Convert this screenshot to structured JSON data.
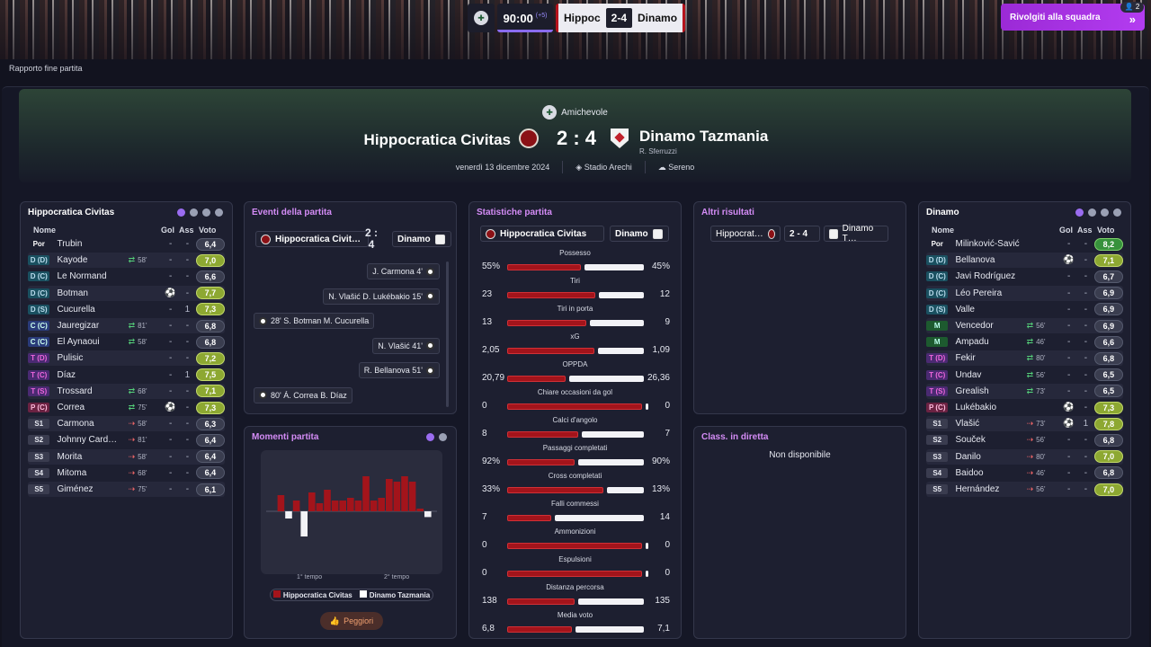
{
  "topbar": {
    "clock": "90:00",
    "added": "(+5)",
    "home": "Hippoc",
    "score": "2-4",
    "away": "Dinamo",
    "squad_btn": "Rivolgiti alla squadra",
    "badge": "2"
  },
  "breadcrumb": "Rapporto fine partita",
  "header": {
    "competition": "Amichevole",
    "home": "Hippocratica Civitas",
    "score": "2 : 4",
    "away": "Dinamo Tazmania",
    "referee": "R. Sferruzzi",
    "date": "venerdì 13 dicembre 2024",
    "stadium": "Stadio Arechi",
    "weather": "Sereno"
  },
  "home_panel": {
    "title": "Hippocratica Civitas",
    "cols": {
      "name": "Nome",
      "gol": "Gol",
      "ass": "Ass",
      "voto": "Voto"
    },
    "players": [
      {
        "pos": "Por",
        "name": "Trubin",
        "sub": "",
        "gol": "-",
        "ass": "-",
        "voto": "6,4"
      },
      {
        "pos": "D (D)",
        "name": "Kayode",
        "sub": "58'",
        "gol": "-",
        "ass": "-",
        "voto": "7,0"
      },
      {
        "pos": "D (C)",
        "name": "Le Normand",
        "sub": "",
        "gol": "-",
        "ass": "-",
        "voto": "6,6"
      },
      {
        "pos": "D (C)",
        "name": "Botman",
        "sub": "",
        "gol": "⚽",
        "ass": "-",
        "voto": "7,7"
      },
      {
        "pos": "D (S)",
        "name": "Cucurella",
        "sub": "",
        "gol": "-",
        "ass": "1",
        "voto": "7,3"
      },
      {
        "pos": "C (C)",
        "name": "Jauregizar",
        "sub": "81'",
        "gol": "-",
        "ass": "-",
        "voto": "6,8"
      },
      {
        "pos": "C (C)",
        "name": "El Aynaoui",
        "sub": "58'",
        "gol": "-",
        "ass": "-",
        "voto": "6,8"
      },
      {
        "pos": "T (D)",
        "name": "Pulisic",
        "sub": "",
        "gol": "-",
        "ass": "-",
        "voto": "7,2"
      },
      {
        "pos": "T (C)",
        "name": "Díaz",
        "sub": "",
        "gol": "-",
        "ass": "1",
        "voto": "7,5"
      },
      {
        "pos": "T (S)",
        "name": "Trossard",
        "sub": "68'",
        "gol": "-",
        "ass": "-",
        "voto": "7,1"
      },
      {
        "pos": "P (C)",
        "name": "Correa",
        "sub": "75'",
        "gol": "⚽",
        "ass": "-",
        "voto": "7,3"
      },
      {
        "pos": "S1",
        "name": "Carmona",
        "sub": "58'",
        "gol": "-",
        "ass": "-",
        "voto": "6,3"
      },
      {
        "pos": "S2",
        "name": "Johnny Card…",
        "sub": "81'",
        "gol": "-",
        "ass": "-",
        "voto": "6,4"
      },
      {
        "pos": "S3",
        "name": "Morita",
        "sub": "58'",
        "gol": "-",
        "ass": "-",
        "voto": "6,4"
      },
      {
        "pos": "S4",
        "name": "Mitoma",
        "sub": "68'",
        "gol": "-",
        "ass": "-",
        "voto": "6,4"
      },
      {
        "pos": "S5",
        "name": "Giménez",
        "sub": "75'",
        "gol": "-",
        "ass": "-",
        "voto": "6,1"
      }
    ]
  },
  "away_panel": {
    "title": "Dinamo",
    "cols": {
      "name": "Nome",
      "gol": "Gol",
      "ass": "Ass",
      "voto": "Voto"
    },
    "players": [
      {
        "pos": "Por",
        "name": "Milinković-Savić",
        "sub": "",
        "gol": "-",
        "ass": "-",
        "voto": "8,2"
      },
      {
        "pos": "D (D)",
        "name": "Bellanova",
        "sub": "",
        "gol": "⚽",
        "ass": "-",
        "voto": "7,1"
      },
      {
        "pos": "D (C)",
        "name": "Javi Rodríguez",
        "sub": "",
        "gol": "-",
        "ass": "-",
        "voto": "6,7"
      },
      {
        "pos": "D (C)",
        "name": "Léo Pereira",
        "sub": "",
        "gol": "-",
        "ass": "-",
        "voto": "6,9"
      },
      {
        "pos": "D (S)",
        "name": "Valle",
        "sub": "",
        "gol": "-",
        "ass": "-",
        "voto": "6,9"
      },
      {
        "pos": "M",
        "name": "Vencedor",
        "sub": "56'",
        "gol": "-",
        "ass": "-",
        "voto": "6,9"
      },
      {
        "pos": "M",
        "name": "Ampadu",
        "sub": "46'",
        "gol": "-",
        "ass": "-",
        "voto": "6,6"
      },
      {
        "pos": "T (D)",
        "name": "Fekir",
        "sub": "80'",
        "gol": "-",
        "ass": "-",
        "voto": "6,8"
      },
      {
        "pos": "T (C)",
        "name": "Undav",
        "sub": "56'",
        "gol": "-",
        "ass": "-",
        "voto": "6,5"
      },
      {
        "pos": "T (S)",
        "name": "Grealish",
        "sub": "73'",
        "gol": "-",
        "ass": "-",
        "voto": "6,5"
      },
      {
        "pos": "P (C)",
        "name": "Lukébakio",
        "sub": "",
        "gol": "⚽",
        "ass": "-",
        "voto": "7,3"
      },
      {
        "pos": "S1",
        "name": "Vlašić",
        "sub": "73'",
        "gol": "⚽",
        "ass": "1",
        "voto": "7,8"
      },
      {
        "pos": "S2",
        "name": "Souček",
        "sub": "56'",
        "gol": "-",
        "ass": "-",
        "voto": "6,8"
      },
      {
        "pos": "S3",
        "name": "Danilo",
        "sub": "80'",
        "gol": "-",
        "ass": "-",
        "voto": "7,0"
      },
      {
        "pos": "S4",
        "name": "Baidoo",
        "sub": "46'",
        "gol": "-",
        "ass": "-",
        "voto": "6,8"
      },
      {
        "pos": "S5",
        "name": "Hernández",
        "sub": "56'",
        "gol": "-",
        "ass": "-",
        "voto": "7,0"
      }
    ]
  },
  "events": {
    "title": "Eventi della partita",
    "home": "Hippocratica Civit…",
    "score": "2 : 4",
    "away": "Dinamo",
    "items": [
      {
        "side": "away",
        "text": "J. Carmona 4'"
      },
      {
        "side": "away",
        "text": "N. Vlašić D. Lukébakio 15'"
      },
      {
        "side": "home",
        "text": "28' S. Botman M. Cucurella"
      },
      {
        "side": "away",
        "text": "N. Vlašić 41'"
      },
      {
        "side": "away",
        "text": "R. Bellanova 51'"
      },
      {
        "side": "home",
        "text": "80' Á. Correa B. Díaz"
      }
    ]
  },
  "moments": {
    "title": "Momenti partita",
    "half1": "1° tempo",
    "half2": "2° tempo",
    "legend_home": "Hippocratica Civitas",
    "legend_away": "Dinamo Tazmania",
    "button": "Peggiori",
    "bars": [
      0,
      0.3,
      0,
      0.2,
      0,
      0.35,
      0.15,
      0.4,
      0.2,
      0.2,
      0.25,
      0.2,
      0.65,
      0.2,
      0.25,
      0.6,
      0.55,
      0.65,
      0.55,
      0.05,
      0
    ],
    "neg": [
      0,
      0,
      0.1,
      0,
      0.35,
      0,
      0,
      0,
      0,
      0,
      0,
      0,
      0,
      0,
      0,
      0,
      0,
      0,
      0,
      0,
      0.08
    ]
  },
  "stats": {
    "title": "Statistiche partita",
    "home": "Hippocratica Civitas",
    "away": "Dinamo",
    "rows": [
      {
        "label": "Possesso",
        "h": "55%",
        "a": "45%",
        "hv": 55,
        "av": 45
      },
      {
        "label": "Tiri",
        "h": "23",
        "a": "12",
        "hv": 23,
        "av": 12
      },
      {
        "label": "Tiri in porta",
        "h": "13",
        "a": "9",
        "hv": 13,
        "av": 9
      },
      {
        "label": "xG",
        "h": "2,05",
        "a": "1,09",
        "hv": 2.05,
        "av": 1.09
      },
      {
        "label": "OPPDA",
        "h": "20,79",
        "a": "26,36",
        "hv": 20.79,
        "av": 26.36
      },
      {
        "label": "Chiare occasioni da gol",
        "h": "0",
        "a": "0",
        "hv": 1,
        "av": 0
      },
      {
        "label": "Calci d'angolo",
        "h": "8",
        "a": "7",
        "hv": 8,
        "av": 7
      },
      {
        "label": "Passaggi completati",
        "h": "92%",
        "a": "90%",
        "hv": 92,
        "av": 90
      },
      {
        "label": "Cross completati",
        "h": "33%",
        "a": "13%",
        "hv": 33,
        "av": 13
      },
      {
        "label": "Falli commessi",
        "h": "7",
        "a": "14",
        "hv": 7,
        "av": 14
      },
      {
        "label": "Ammonizioni",
        "h": "0",
        "a": "0",
        "hv": 1,
        "av": 0
      },
      {
        "label": "Espulsioni",
        "h": "0",
        "a": "0",
        "hv": 1,
        "av": 0
      },
      {
        "label": "Distanza percorsa",
        "h": "138",
        "a": "135",
        "hv": 138,
        "av": 135
      },
      {
        "label": "Media voto",
        "h": "6,8",
        "a": "7,1",
        "hv": 6.8,
        "av": 7.1
      }
    ]
  },
  "other": {
    "title": "Altri risultati",
    "home": "Hippocrat…",
    "score": "2 - 4",
    "away": "Dinamo T…"
  },
  "live": {
    "title": "Class. in diretta",
    "empty": "Non disponibile"
  },
  "colors": {
    "home": "#a3141b",
    "away": "#f2f2f6",
    "accent": "#9a6cf0"
  }
}
